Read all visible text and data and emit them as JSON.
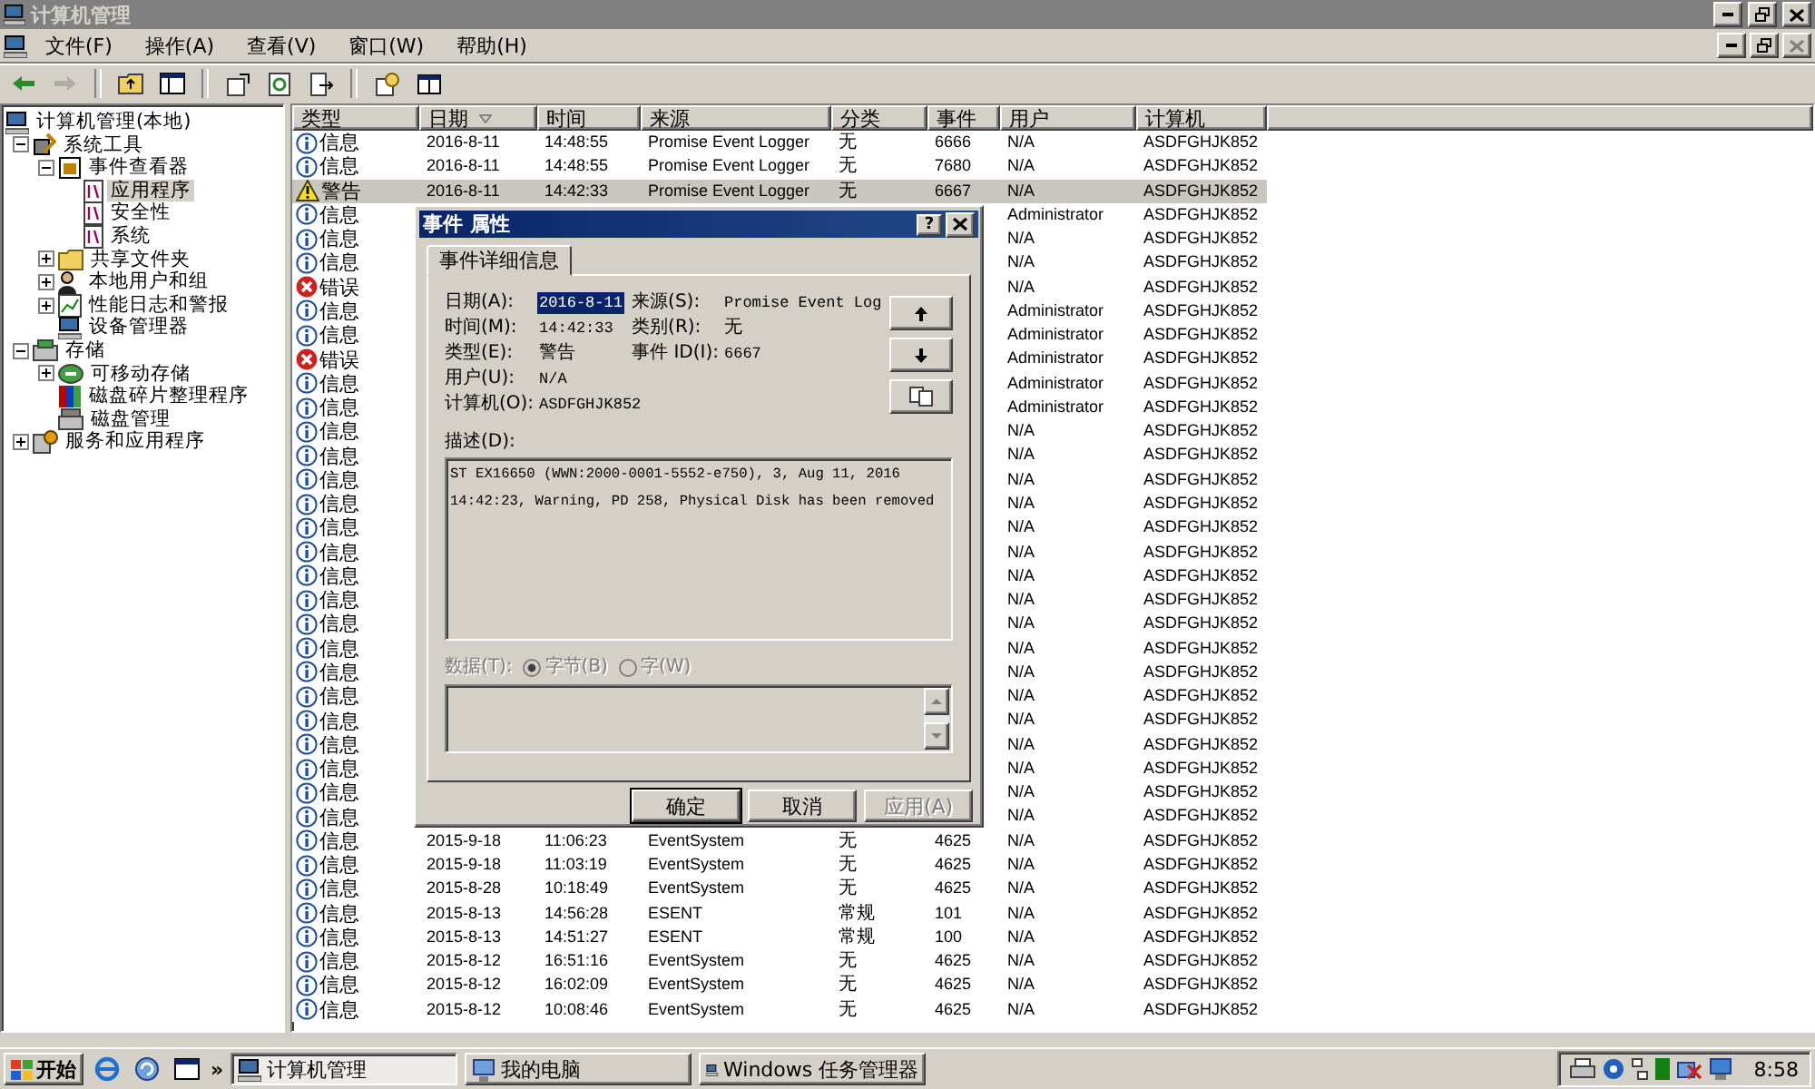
{
  "window": {
    "title": "计算机管理"
  },
  "menu": {
    "items": [
      "文件(F)",
      "操作(A)",
      "查看(V)",
      "窗口(W)",
      "帮助(H)"
    ]
  },
  "toolbar": [
    {
      "kind": "back",
      "disabled": false
    },
    {
      "kind": "forward",
      "disabled": true
    },
    {
      "kind": "separator"
    },
    {
      "kind": "up",
      "disabled": false
    },
    {
      "kind": "tree",
      "disabled": false
    },
    {
      "kind": "separator"
    },
    {
      "kind": "properties",
      "disabled": false
    },
    {
      "kind": "refresh",
      "disabled": false
    },
    {
      "kind": "export",
      "disabled": false
    },
    {
      "kind": "separator"
    },
    {
      "kind": "help",
      "disabled": false
    },
    {
      "kind": "pane",
      "disabled": false
    }
  ],
  "tree": {
    "items": [
      {
        "label": "计算机管理(本地)",
        "kind": "computer",
        "selected": false,
        "children": [
          {
            "label": "系统工具",
            "kind": "tools",
            "expandable": true,
            "expanded": true,
            "selected": false,
            "children": [
              {
                "label": "事件查看器",
                "kind": "viewer",
                "expandable": true,
                "expanded": true,
                "selected": false,
                "children": [
                  {
                    "label": "应用程序",
                    "kind": "log",
                    "expandable": false,
                    "expanded": false,
                    "selected": true
                  },
                  {
                    "label": "安全性",
                    "kind": "log",
                    "expandable": false,
                    "expanded": false,
                    "selected": false
                  },
                  {
                    "label": "系统",
                    "kind": "log",
                    "expandable": false,
                    "expanded": false,
                    "selected": false
                  }
                ]
              },
              {
                "label": "共享文件夹",
                "kind": "folder",
                "expandable": true,
                "expanded": false,
                "selected": false
              },
              {
                "label": "本地用户和组",
                "kind": "users",
                "expandable": true,
                "expanded": false,
                "selected": false
              },
              {
                "label": "性能日志和警报",
                "kind": "perf",
                "expandable": true,
                "expanded": false,
                "selected": false
              },
              {
                "label": "设备管理器",
                "kind": "device",
                "expandable": false,
                "expanded": false,
                "selected": false
              }
            ]
          },
          {
            "label": "存储",
            "kind": "storage",
            "expandable": true,
            "expanded": true,
            "selected": false,
            "children": [
              {
                "label": "可移动存储",
                "kind": "removable",
                "expandable": true,
                "expanded": false,
                "selected": false
              },
              {
                "label": "磁盘碎片整理程序",
                "kind": "defrag",
                "expandable": false,
                "expanded": false,
                "selected": false
              },
              {
                "label": "磁盘管理",
                "kind": "disk",
                "expandable": false,
                "expanded": false,
                "selected": false
              }
            ]
          },
          {
            "label": "服务和应用程序",
            "kind": "services",
            "expandable": true,
            "expanded": false,
            "selected": false
          }
        ]
      }
    ]
  },
  "event_list": {
    "columns": [
      {
        "label": "类型",
        "sorted": false
      },
      {
        "label": "日期",
        "sorted": true
      },
      {
        "label": "时间",
        "sorted": false
      },
      {
        "label": "来源",
        "sorted": false
      },
      {
        "label": "分类",
        "sorted": false
      },
      {
        "label": "事件",
        "sorted": false
      },
      {
        "label": "用户",
        "sorted": false
      },
      {
        "label": "计算机",
        "sorted": false
      }
    ],
    "rows": [
      {
        "kind": "info",
        "type": "信息",
        "date": "2016-8-11",
        "time": "14:48:55",
        "source": "Promise Event Logger",
        "category": "无",
        "event": "6666",
        "user": "N/A",
        "computer": "ASDFGHJK852",
        "selected": false
      },
      {
        "kind": "info",
        "type": "信息",
        "date": "2016-8-11",
        "time": "14:48:55",
        "source": "Promise Event Logger",
        "category": "无",
        "event": "7680",
        "user": "N/A",
        "computer": "ASDFGHJK852",
        "selected": false
      },
      {
        "kind": "warning",
        "type": "警告",
        "date": "2016-8-11",
        "time": "14:42:33",
        "source": "Promise Event Logger",
        "category": "无",
        "event": "6667",
        "user": "N/A",
        "computer": "ASDFGHJK852",
        "selected": true
      },
      {
        "kind": "info",
        "type": "信息",
        "user": "Administrator",
        "computer": "ASDFGHJK852",
        "selected": false
      },
      {
        "kind": "info",
        "type": "信息",
        "user": "N/A",
        "computer": "ASDFGHJK852",
        "selected": false
      },
      {
        "kind": "info",
        "type": "信息",
        "user": "N/A",
        "computer": "ASDFGHJK852",
        "selected": false
      },
      {
        "kind": "error",
        "type": "错误",
        "user": "N/A",
        "computer": "ASDFGHJK852",
        "selected": false
      },
      {
        "kind": "info",
        "type": "信息",
        "user": "Administrator",
        "computer": "ASDFGHJK852",
        "selected": false
      },
      {
        "kind": "info",
        "type": "信息",
        "user": "Administrator",
        "computer": "ASDFGHJK852",
        "selected": false
      },
      {
        "kind": "error",
        "type": "错误",
        "user": "Administrator",
        "computer": "ASDFGHJK852",
        "selected": false
      },
      {
        "kind": "info",
        "type": "信息",
        "user": "Administrator",
        "computer": "ASDFGHJK852",
        "selected": false
      },
      {
        "kind": "info",
        "type": "信息",
        "user": "Administrator",
        "computer": "ASDFGHJK852",
        "selected": false
      },
      {
        "kind": "info",
        "type": "信息",
        "user": "N/A",
        "computer": "ASDFGHJK852",
        "selected": false
      },
      {
        "kind": "info",
        "type": "信息",
        "user": "N/A",
        "computer": "ASDFGHJK852",
        "selected": false
      },
      {
        "kind": "info",
        "type": "信息",
        "user": "N/A",
        "computer": "ASDFGHJK852",
        "selected": false
      },
      {
        "kind": "info",
        "type": "信息",
        "user": "N/A",
        "computer": "ASDFGHJK852",
        "selected": false
      },
      {
        "kind": "info",
        "type": "信息",
        "user": "N/A",
        "computer": "ASDFGHJK852",
        "selected": false
      },
      {
        "kind": "info",
        "type": "信息",
        "user": "N/A",
        "computer": "ASDFGHJK852",
        "selected": false
      },
      {
        "kind": "info",
        "type": "信息",
        "user": "N/A",
        "computer": "ASDFGHJK852",
        "selected": false
      },
      {
        "kind": "info",
        "type": "信息",
        "user": "N/A",
        "computer": "ASDFGHJK852",
        "selected": false
      },
      {
        "kind": "info",
        "type": "信息",
        "user": "N/A",
        "computer": "ASDFGHJK852",
        "selected": false
      },
      {
        "kind": "info",
        "type": "信息",
        "user": "N/A",
        "computer": "ASDFGHJK852",
        "selected": false
      },
      {
        "kind": "info",
        "type": "信息",
        "user": "N/A",
        "computer": "ASDFGHJK852",
        "selected": false
      },
      {
        "kind": "info",
        "type": "信息",
        "user": "N/A",
        "computer": "ASDFGHJK852",
        "selected": false
      },
      {
        "kind": "info",
        "type": "信息",
        "user": "N/A",
        "computer": "ASDFGHJK852",
        "selected": false
      },
      {
        "kind": "info",
        "type": "信息",
        "user": "N/A",
        "computer": "ASDFGHJK852",
        "selected": false
      },
      {
        "kind": "info",
        "type": "信息",
        "user": "N/A",
        "computer": "ASDFGHJK852",
        "selected": false
      },
      {
        "kind": "info",
        "type": "信息",
        "user": "N/A",
        "computer": "ASDFGHJK852",
        "selected": false
      },
      {
        "kind": "info",
        "type": "信息",
        "user": "N/A",
        "computer": "ASDFGHJK852",
        "selected": false
      },
      {
        "kind": "info",
        "type": "信息",
        "date": "2015-9-18",
        "time": "11:06:23",
        "source": "EventSystem",
        "category": "无",
        "event": "4625",
        "user": "N/A",
        "computer": "ASDFGHJK852",
        "selected": false
      },
      {
        "kind": "info",
        "type": "信息",
        "date": "2015-9-18",
        "time": "11:03:19",
        "source": "EventSystem",
        "category": "无",
        "event": "4625",
        "user": "N/A",
        "computer": "ASDFGHJK852",
        "selected": false
      },
      {
        "kind": "info",
        "type": "信息",
        "date": "2015-8-28",
        "time": "10:18:49",
        "source": "EventSystem",
        "category": "无",
        "event": "4625",
        "user": "N/A",
        "computer": "ASDFGHJK852",
        "selected": false
      },
      {
        "kind": "info",
        "type": "信息",
        "date": "2015-8-13",
        "time": "14:56:28",
        "source": "ESENT",
        "category": "常规",
        "event": "101",
        "user": "N/A",
        "computer": "ASDFGHJK852",
        "selected": false
      },
      {
        "kind": "info",
        "type": "信息",
        "date": "2015-8-13",
        "time": "14:51:27",
        "source": "ESENT",
        "category": "常规",
        "event": "100",
        "user": "N/A",
        "computer": "ASDFGHJK852",
        "selected": false
      },
      {
        "kind": "info",
        "type": "信息",
        "date": "2015-8-12",
        "time": "16:51:16",
        "source": "EventSystem",
        "category": "无",
        "event": "4625",
        "user": "N/A",
        "computer": "ASDFGHJK852",
        "selected": false
      },
      {
        "kind": "info",
        "type": "信息",
        "date": "2015-8-12",
        "time": "16:02:09",
        "source": "EventSystem",
        "category": "无",
        "event": "4625",
        "user": "N/A",
        "computer": "ASDFGHJK852",
        "selected": false
      },
      {
        "kind": "info",
        "type": "信息",
        "date": "2015-8-12",
        "time": "10:08:46",
        "source": "EventSystem",
        "category": "无",
        "event": "4625",
        "user": "N/A",
        "computer": "ASDFGHJK852",
        "selected": false
      }
    ]
  },
  "dialog": {
    "title": "事件 属性",
    "help_button": "?",
    "tabs": [
      {
        "label": "事件详细信息",
        "selected": true
      }
    ],
    "left_fields": [
      {
        "label": "日期(A):",
        "value": "2016-8-11",
        "highlighted": true
      },
      {
        "label": "时间(M):",
        "value": "14:42:33",
        "highlighted": false
      },
      {
        "label": "类型(E):",
        "value": "警告",
        "highlighted": false
      },
      {
        "label": "用户(U):",
        "value": "N/A",
        "highlighted": false
      },
      {
        "label": "计算机(O):",
        "value": "ASDFGHJK852",
        "highlighted": false
      }
    ],
    "right_fields": [
      {
        "label": "来源(S):",
        "value": "Promise Event Log"
      },
      {
        "label": "类别(R):",
        "value": "无"
      },
      {
        "label": "事件 ID(I):",
        "value": "6667"
      }
    ],
    "description": {
      "label": "描述(D):",
      "text": "ST EX16650 (WWN:2000-0001-5552-e750), 3, Aug 11, 2016 14:42:23, Warning, PD 258, Physical Disk has been removed"
    },
    "data": {
      "label": "数据(T):",
      "disabled": true,
      "options": [
        {
          "label": "字节(B)",
          "selected": true
        },
        {
          "label": "字(W)",
          "selected": false
        }
      ]
    },
    "buttons": [
      {
        "label": "确定",
        "default": true,
        "disabled": false
      },
      {
        "label": "取消",
        "default": false,
        "disabled": false
      },
      {
        "label": "应用(A)",
        "default": false,
        "disabled": true
      }
    ]
  },
  "taskbar": {
    "start": "开始",
    "more": "»",
    "tasks": [
      {
        "label": "计算机管理",
        "kind": "computer",
        "selected": true
      },
      {
        "label": "我的电脑",
        "kind": "mycomputer",
        "selected": false
      },
      {
        "label": "Windows 任务管理器",
        "kind": "computer",
        "selected": false
      }
    ],
    "clock": "8:58"
  }
}
